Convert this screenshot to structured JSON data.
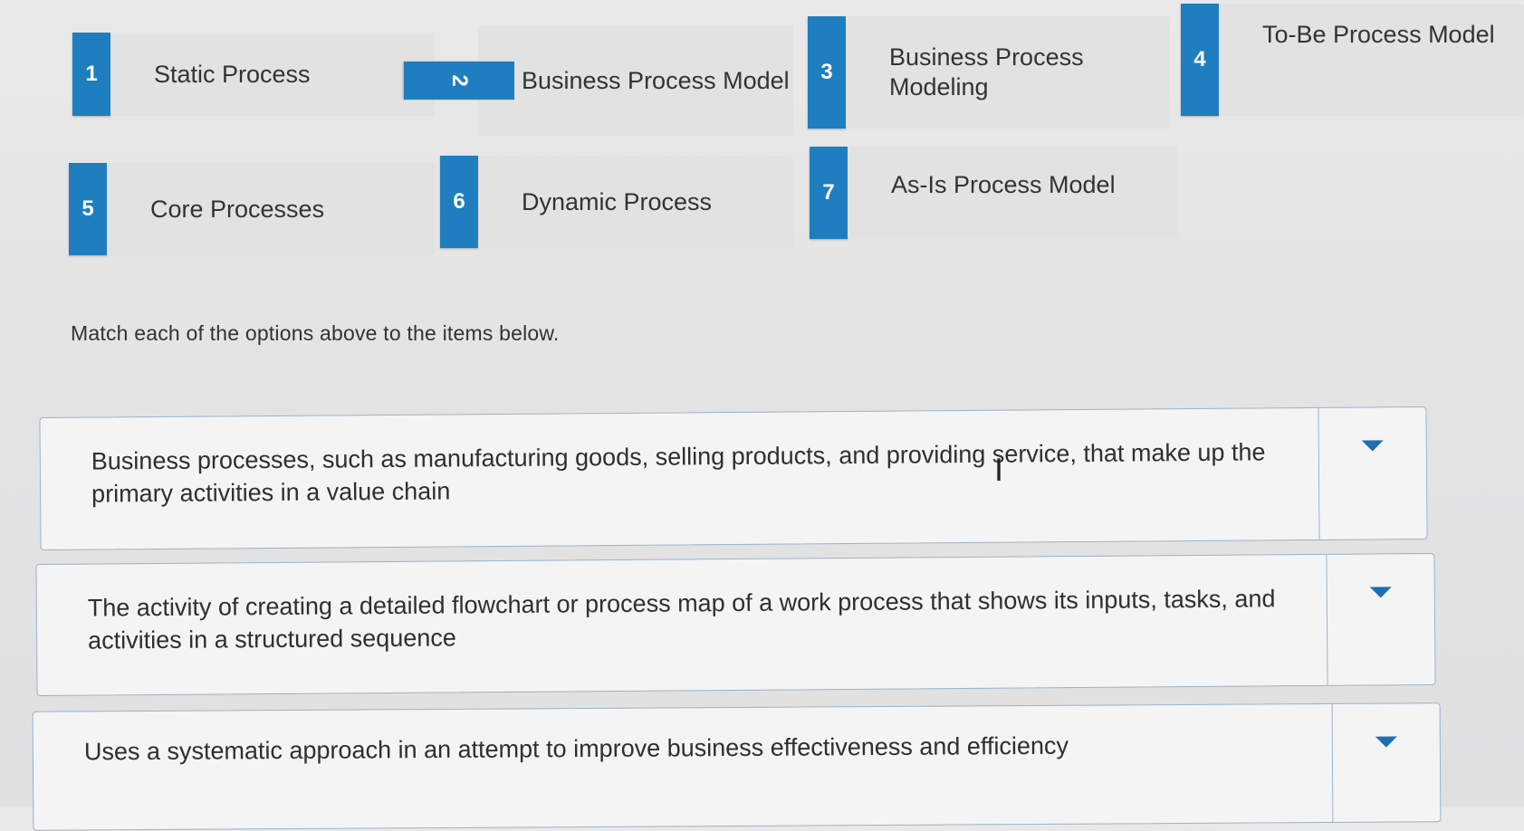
{
  "options": [
    {
      "number": "1",
      "label": "Static Process"
    },
    {
      "number": "2",
      "label": "Business Process Model"
    },
    {
      "number": "3",
      "label": "Business Process Modeling"
    },
    {
      "number": "4",
      "label": "To-Be Process Model"
    },
    {
      "number": "5",
      "label": "Core Processes"
    },
    {
      "number": "6",
      "label": "Dynamic Process"
    },
    {
      "number": "7",
      "label": "As-Is Process Model"
    }
  ],
  "instructions": "Match each of the options above to the items below.",
  "items": [
    {
      "text": "Business processes, such as manufacturing goods, selling products, and providing service, that make up the primary activities in a value chain",
      "selected": ""
    },
    {
      "text": "The activity of creating a detailed flowchart or process map of a work process that shows its inputs, tasks, and activities in a structured sequence",
      "selected": ""
    },
    {
      "text": "Uses a systematic approach in an attempt to improve business effectiveness and efficiency",
      "selected": ""
    }
  ],
  "icons": {
    "dropdown": "caret-down-icon",
    "cursor": "text-cursor-icon"
  },
  "colors": {
    "badge": "#1f7ec0",
    "caret": "#1f6fb0",
    "border": "#9ab3c7"
  }
}
